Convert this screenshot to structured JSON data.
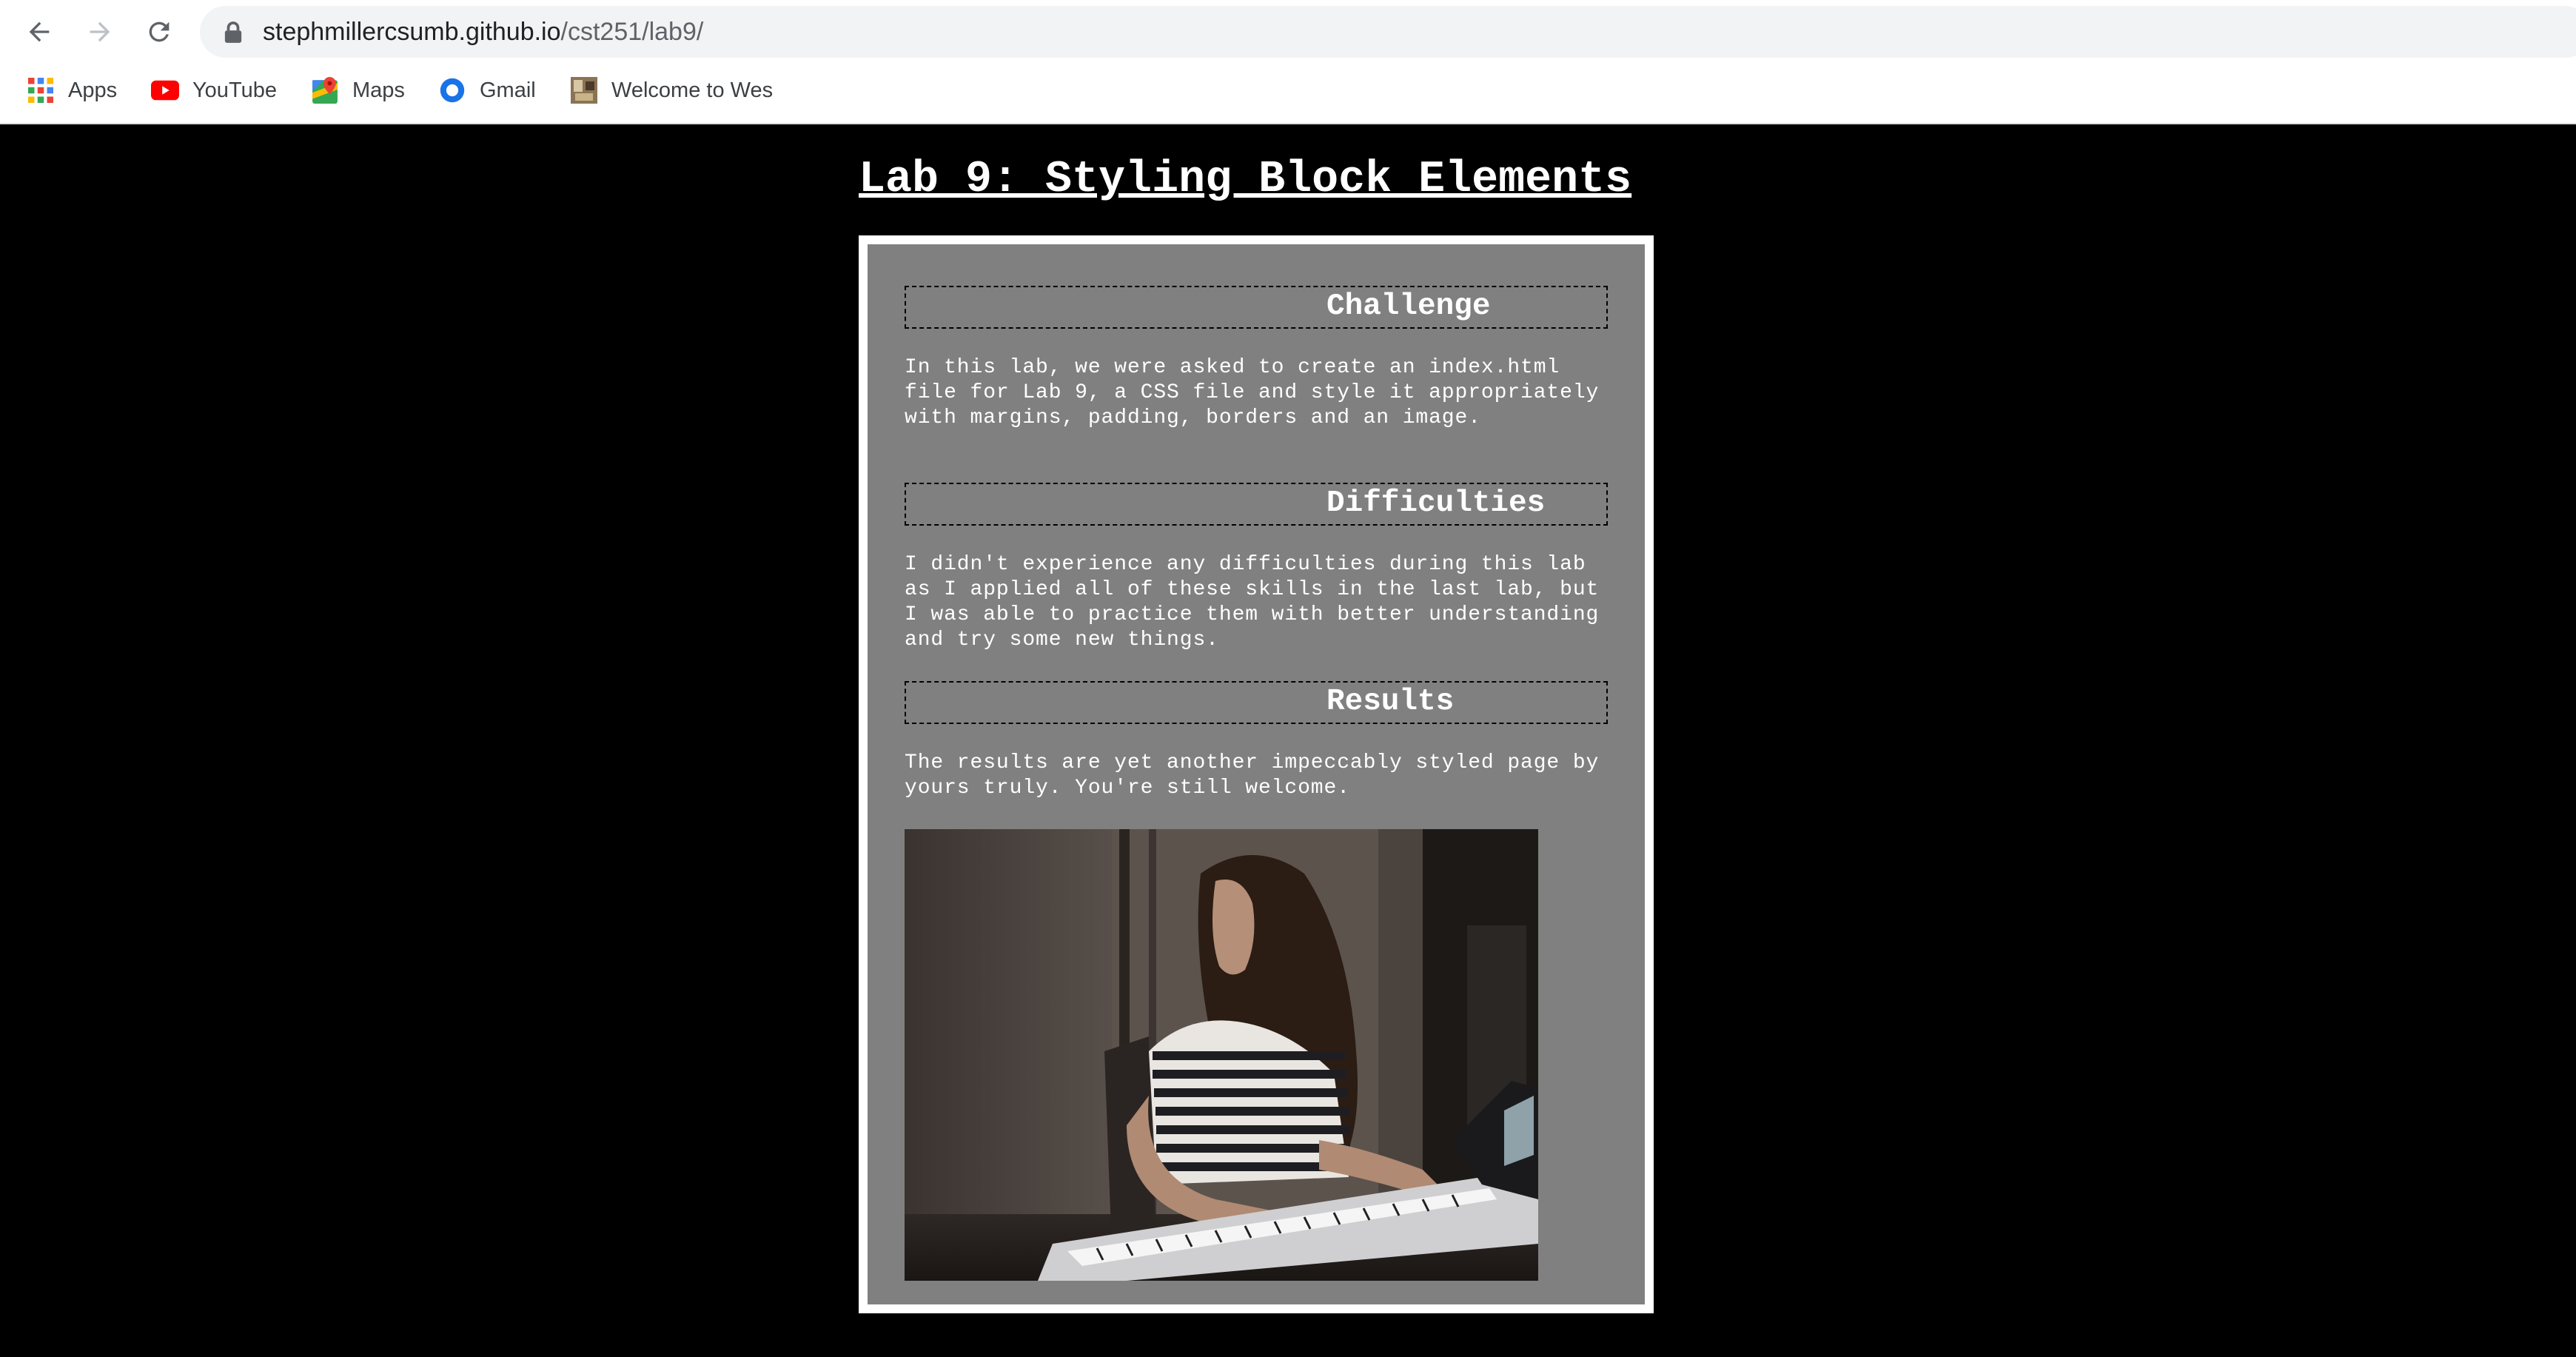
{
  "browser": {
    "url_host": "stephmillercsumb.github.io",
    "url_path": "/cst251/lab9/",
    "bookmarks": [
      {
        "label": "Apps",
        "icon": "apps-grid-icon"
      },
      {
        "label": "YouTube",
        "icon": "youtube-icon"
      },
      {
        "label": "Maps",
        "icon": "maps-icon"
      },
      {
        "label": "Gmail",
        "icon": "gmail-icon"
      },
      {
        "label": "Welcome to Wes",
        "icon": "site-favicon-icon"
      }
    ]
  },
  "page": {
    "title": "Lab 9: Styling Block Elements",
    "sections": [
      {
        "heading": "Challenge",
        "text": "In this lab, we were asked to create an index.html file for Lab 9, a CSS file and style it appropriately with margins, padding, borders and an image."
      },
      {
        "heading": "Difficulties",
        "text": "I didn't experience any difficulties during this lab as I applied all of these skills in the last lab, but I was able to practice them with better understanding and try some new things."
      },
      {
        "heading": "Results",
        "text": "The results are yet another impeccably styled page by yours truly. You're still welcome."
      }
    ]
  },
  "colors": {
    "page_background": "#000000",
    "card_background": "#808080",
    "card_border": "#ffffff",
    "text": "#ffffff"
  }
}
